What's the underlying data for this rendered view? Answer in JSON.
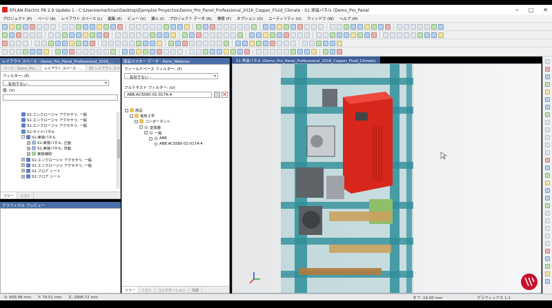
{
  "window": {
    "title": "EPLAN Electric P8 2.9 Update 1 - C:\\Users\\emartinez\\Desktop\\Ejemplos Proyectos\\Demo_Pro_Panel_Professional_2016_Copper_Fluid_Climate - S1:実装パネル (Demo_Pro_Panel",
    "minimize": "─",
    "maximize": "□",
    "close": "✕"
  },
  "menu": [
    "プロジェクト (P)",
    "ページ (A)",
    "レイアウト スペース (L)",
    "編集 (E)",
    "ビュー (V)",
    "挿入 (I)",
    "プロジェクト データ (R)",
    "検索 (F)",
    "オプション (O)",
    "ユーティリティ (U)",
    "ウィンドウ (W)",
    "ヘルプ (H)"
  ],
  "left_panel": {
    "header": "レイアウト スペース - Demo_Pro_Panel_Professional_2016_...",
    "tabs": [
      "ページ - Demo_Pro...",
      "レイアウト スペース - ...",
      "3D レイアウト スペー..."
    ],
    "filter_label": "フィルター: (E)",
    "filter_value": "- 有効でない -",
    "value_label": "値: (V)",
    "tree": [
      {
        "text": "S1:エンクロージャ アクセサリ, 一般",
        "icon": "cabinet-icon",
        "indent": 1,
        "exp": ""
      },
      {
        "text": "S1:エンクロージャ アクセサリ, 一般",
        "icon": "cabinet-icon",
        "indent": 1,
        "exp": ""
      },
      {
        "text": "S1:エンクロージャ アクセサリ, 一般",
        "icon": "cabinet-icon",
        "indent": 1,
        "exp": ""
      },
      {
        "text": "S1:サイドパネル",
        "icon": "cabinet-icon",
        "indent": 1,
        "exp": ""
      },
      {
        "text": "S1:実装パネル",
        "icon": "cabinet-icon",
        "indent": 1,
        "exp": "-"
      },
      {
        "text": "S1:実装パネル, 正面",
        "icon": "mounting-plate-icon",
        "indent": 2,
        "exp": "+"
      },
      {
        "text": "S1:実装パネル, 背面",
        "icon": "mounting-plate-icon",
        "indent": 2,
        "exp": "+"
      },
      {
        "text": "実装補助",
        "icon": "part-icon",
        "indent": 2,
        "exp": "+"
      },
      {
        "text": "S1:エンクロージャ アクセサリ, 一般",
        "icon": "cabinet-icon",
        "indent": 1,
        "exp": "+"
      },
      {
        "text": "S1:エンクロージャ アクセサリ, 一般",
        "icon": "cabinet-icon",
        "indent": 1,
        "exp": "+"
      },
      {
        "text": "S1:フロア シート",
        "icon": "cabinet-icon",
        "indent": 1,
        "exp": "+"
      },
      {
        "text": "S1:フロア シート",
        "icon": "cabinet-icon",
        "indent": 1,
        "exp": "+"
      }
    ],
    "bottom_tabs": [
      "ツリー",
      "リスト"
    ]
  },
  "preview_panel": {
    "header": "グラフィカル プレビュー"
  },
  "parts_panel": {
    "header": "部品マスター データ - Parts_Webinar",
    "field_filter_label": "フィールドベース フィルター: (F)",
    "field_filter_value": "- 有効でない -",
    "fulltext_label": "フルテキスト フィルター: (U)",
    "fulltext_value": "ABB.ACS580-01-017A-4",
    "tree": [
      {
        "text": "部品",
        "icon": "folder-icon",
        "indent": 0,
        "exp": "-"
      },
      {
        "text": "電気工学",
        "icon": "folder-icon",
        "indent": 1,
        "exp": "-"
      },
      {
        "text": "コンポーネント",
        "icon": "folder-icon",
        "indent": 2,
        "exp": "-"
      },
      {
        "text": "変換器",
        "icon": "manufacturer-icon",
        "indent": 3,
        "exp": "-"
      },
      {
        "text": "一般",
        "icon": "manufacturer-icon",
        "indent": 4,
        "exp": "-"
      },
      {
        "text": "ABB",
        "icon": "manufacturer-icon",
        "indent": 5,
        "exp": "-"
      },
      {
        "text": "ABB.ACS580-01-017A-4",
        "icon": "manufacturer-icon",
        "indent": 6,
        "exp": ""
      }
    ],
    "bottom_tabs": [
      "ツリー",
      "リスト",
      "コンビネーション",
      "情報"
    ]
  },
  "viewport": {
    "tab": "S1:実装パネル (Demo_Pro_Panel_Professional_2016_Copper_Fluid_Climate)"
  },
  "status": {
    "x": "X: 609.99 mm",
    "y": "Y: 79.51 mm",
    "z": "Z: 2906.72 mm",
    "grid": "オフ: 10.00 mm",
    "graphics": "グラフィックス 1:1"
  },
  "colors": {
    "frame": "#2f8f9a",
    "drive": "#e0241b",
    "header": "#4a6fa8"
  }
}
